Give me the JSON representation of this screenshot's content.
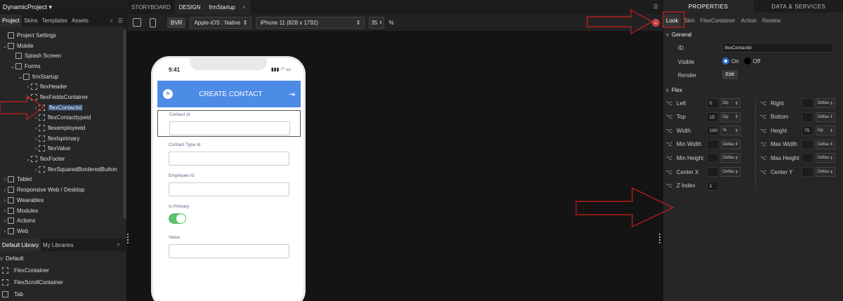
{
  "project": {
    "name": "DynamicProject"
  },
  "left_tabs": [
    "Project",
    "Skins",
    "Templates",
    "Assets"
  ],
  "tree": [
    {
      "label": "Project Settings",
      "depth": 0,
      "chev": "",
      "icon": "settings-icon"
    },
    {
      "label": "Mobile",
      "depth": 0,
      "chev": "v",
      "icon": "mobile-icon"
    },
    {
      "label": "Splash Screen",
      "depth": 1,
      "chev": "",
      "icon": "screen-icon"
    },
    {
      "label": "Forms",
      "depth": 1,
      "chev": "v",
      "icon": "folder-icon"
    },
    {
      "label": "frmStartup",
      "depth": 2,
      "chev": "v",
      "icon": "form-icon"
    },
    {
      "label": "flexHeader",
      "depth": 3,
      "chev": ">",
      "icon": "flex-icon"
    },
    {
      "label": "flexFieldsContainer",
      "depth": 3,
      "chev": "v",
      "icon": "flex-icon"
    },
    {
      "label": "flexContactid",
      "depth": 4,
      "chev": ">",
      "icon": "flex-icon",
      "selected": true
    },
    {
      "label": "flexContacttypeid",
      "depth": 4,
      "chev": ">",
      "icon": "flex-icon"
    },
    {
      "label": "flexemployeeid",
      "depth": 4,
      "chev": ">",
      "icon": "flex-icon"
    },
    {
      "label": "flexIsprimary",
      "depth": 4,
      "chev": ">",
      "icon": "flex-icon"
    },
    {
      "label": "flexValue",
      "depth": 4,
      "chev": ">",
      "icon": "flex-icon"
    },
    {
      "label": "flexFooter",
      "depth": 3,
      "chev": "v",
      "icon": "flex-icon"
    },
    {
      "label": "flexSquaredBorderedButton",
      "depth": 4,
      "chev": ">",
      "icon": "flex-icon"
    },
    {
      "label": "Tablet",
      "depth": 0,
      "chev": ">",
      "icon": "tablet-icon"
    },
    {
      "label": "Responsive Web / Desktop",
      "depth": 0,
      "chev": ">",
      "icon": "desktop-icon"
    },
    {
      "label": "Wearables",
      "depth": 0,
      "chev": ">",
      "icon": "watch-icon"
    },
    {
      "label": "Modules",
      "depth": 0,
      "chev": ">",
      "icon": "module-icon"
    },
    {
      "label": "Actions",
      "depth": 0,
      "chev": ">",
      "icon": "action-icon"
    },
    {
      "label": "Web",
      "depth": 0,
      "chev": ">",
      "icon": "web-icon"
    }
  ],
  "library_tabs": [
    "Default Library",
    "My Libraries"
  ],
  "library": {
    "group": "Default",
    "items": [
      "FlexContainer",
      "FlexScrollContainer",
      "Tab"
    ]
  },
  "center_tabs": [
    "STORYBOARD",
    "DESIGN",
    "frmStartup"
  ],
  "toolbar": {
    "bvr": "BVR",
    "platform": "Apple-iOS : Native",
    "device": "iPhone 11 (828 x 1792)",
    "zoom": "35",
    "zoom_unit": "%"
  },
  "phone": {
    "time": "9:41",
    "header_title": "CREATE CONTACT",
    "logo_text": "ik",
    "fields": [
      "Contact Id",
      "Contact Type Id",
      "Employee Id",
      "Is Primary",
      "Value"
    ]
  },
  "right_tabs": [
    "PROPERTIES",
    "DATA & SERVICES"
  ],
  "sub_tabs": [
    "Look",
    "Skin",
    "FlexContainer",
    "Action",
    "Review"
  ],
  "general": {
    "title": "General",
    "id_label": "ID",
    "id_value": "flexContactid",
    "visible_label": "Visible",
    "on_label": "On",
    "off_label": "Off",
    "render_label": "Render",
    "edit_label": "Edit"
  },
  "flex": {
    "title": "Flex",
    "left": {
      "label": "Left",
      "value": "0",
      "unit": "Dp"
    },
    "top": {
      "label": "Top",
      "value": "15",
      "unit": "Dp"
    },
    "width": {
      "label": "Width",
      "value": "100",
      "unit": "%"
    },
    "min_width": {
      "label": "Min Width",
      "value": "",
      "unit": "Defau"
    },
    "min_height": {
      "label": "Min Height",
      "value": "",
      "unit": "Defau"
    },
    "center_x": {
      "label": "Center X",
      "value": "",
      "unit": "Defau"
    },
    "z_index": {
      "label": "Z Index",
      "value": "1"
    },
    "right": {
      "label": "Right",
      "value": "",
      "unit": "Defau"
    },
    "bottom": {
      "label": "Bottom",
      "value": "",
      "unit": "Defau"
    },
    "height": {
      "label": "Height",
      "value": "75",
      "unit": "Dp"
    },
    "max_width": {
      "label": "Max Width",
      "value": "",
      "unit": "Defau"
    },
    "max_height": {
      "label": "Max Height",
      "value": "",
      "unit": "Defau"
    },
    "center_y": {
      "label": "Center Y",
      "value": "",
      "unit": "Defau"
    }
  },
  "colors": {
    "accent": "#4c8be6",
    "annotation": "#cc1f1f",
    "toggle_on": "#5bc16a",
    "selection": "#2f4b72"
  }
}
